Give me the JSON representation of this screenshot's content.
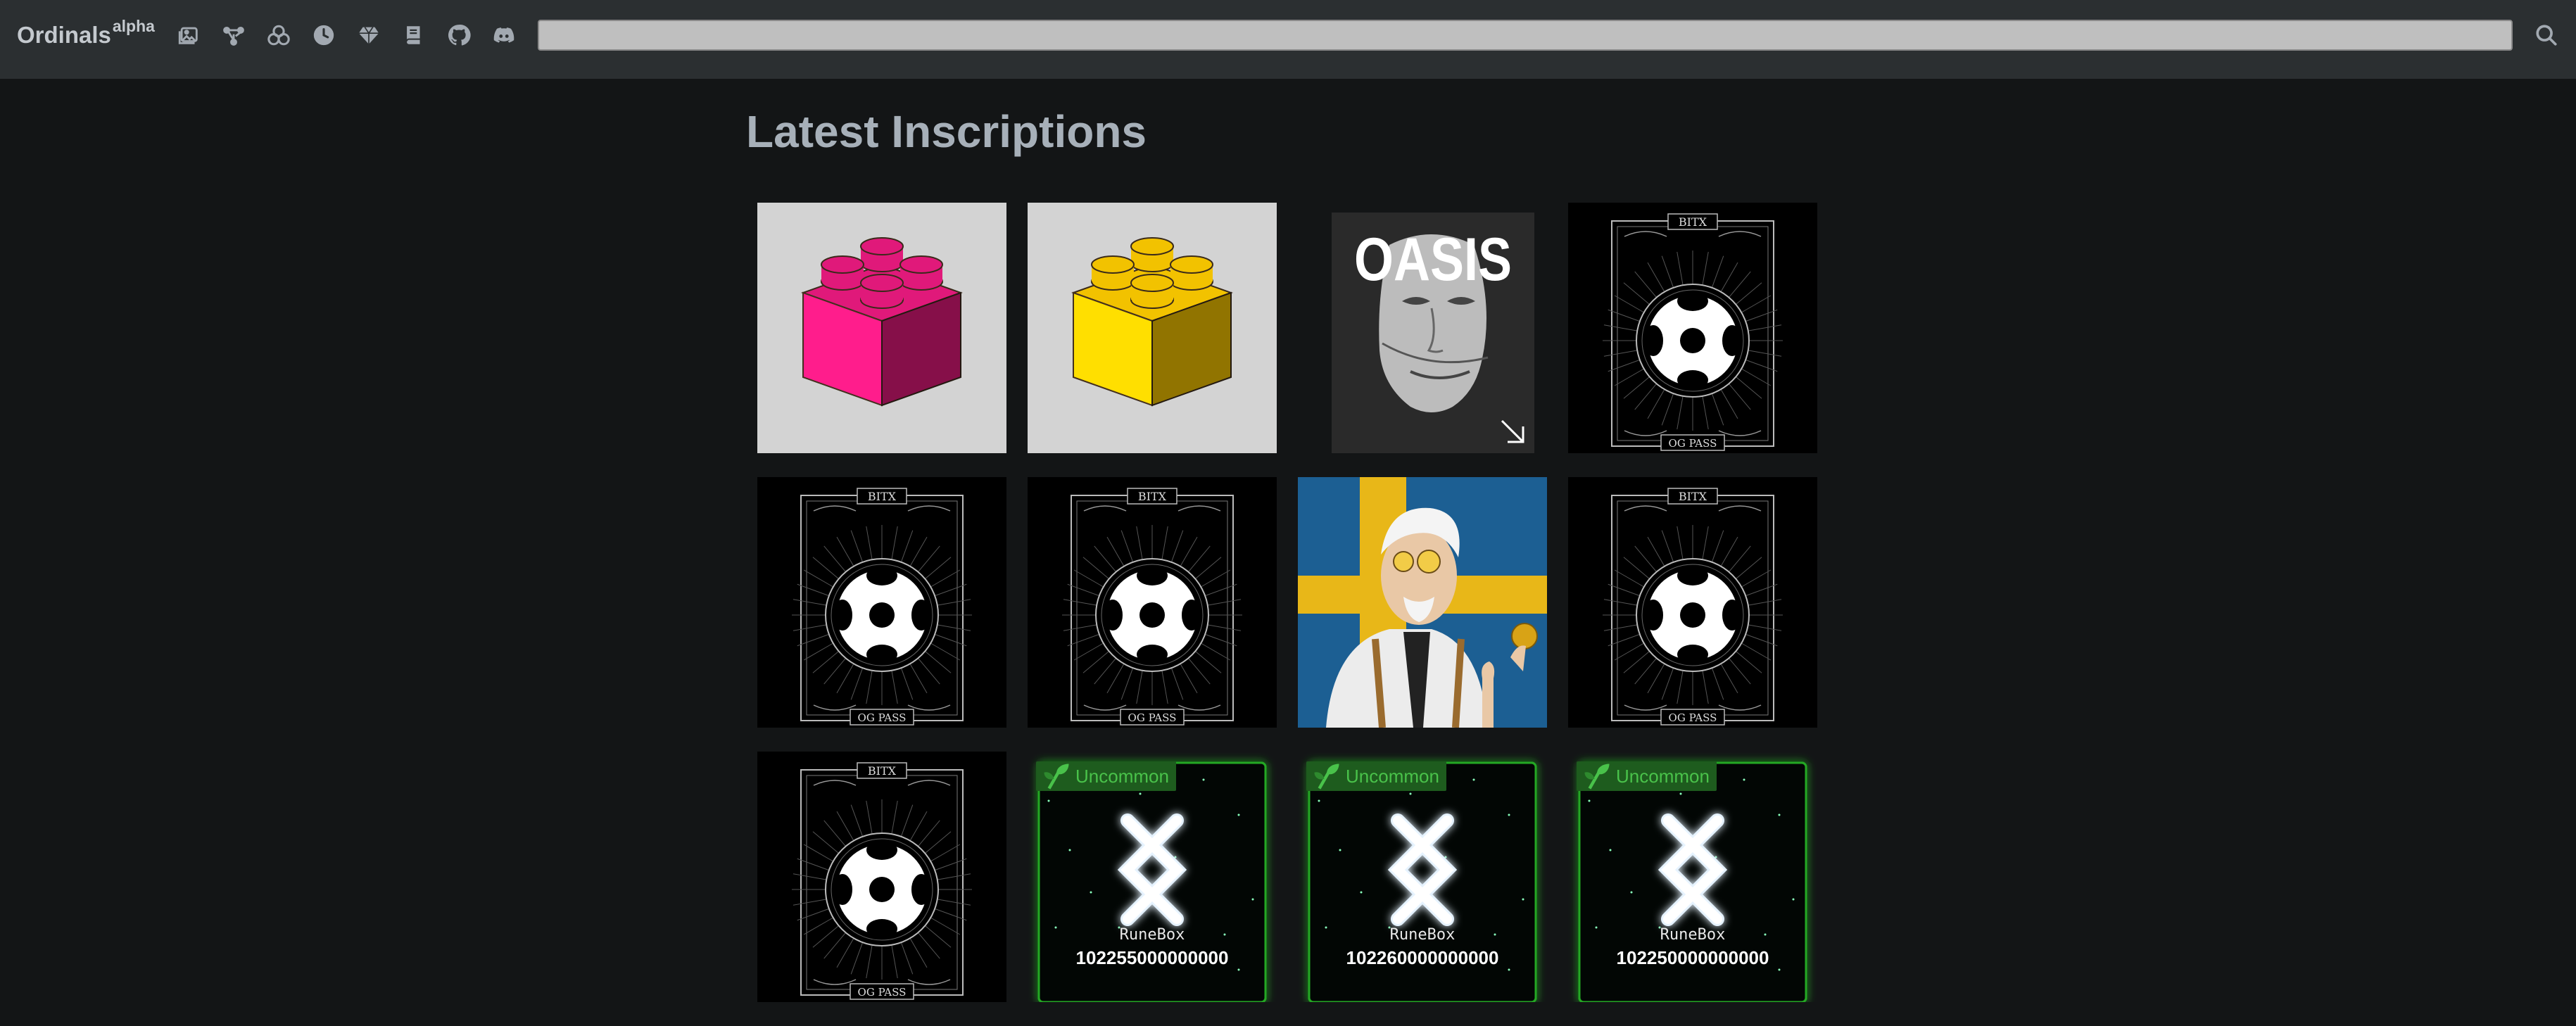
{
  "nav": {
    "brand": "Ordinals",
    "brand_sup": "alpha",
    "icons": [
      "gallery-icon",
      "network-icon",
      "blobs-icon",
      "clock-icon",
      "gem-icon",
      "book-icon",
      "github-icon",
      "discord-icon"
    ],
    "search_placeholder": "",
    "search_icon": "search-icon"
  },
  "page": {
    "title": "Latest Inscriptions"
  },
  "inscriptions": [
    {
      "kind": "brick",
      "color": "#e0197a"
    },
    {
      "kind": "brick",
      "color": "#f2c200"
    },
    {
      "kind": "oasis",
      "text": "OASIS"
    },
    {
      "kind": "ogpass",
      "top": "BITX",
      "bottom": "OG PASS"
    },
    {
      "kind": "ogpass",
      "top": "BITX",
      "bottom": "OG PASS"
    },
    {
      "kind": "ogpass",
      "top": "BITX",
      "bottom": "OG PASS"
    },
    {
      "kind": "portrait"
    },
    {
      "kind": "ogpass",
      "top": "BITX",
      "bottom": "OG PASS"
    },
    {
      "kind": "ogpass",
      "top": "BITX",
      "bottom": "OG PASS"
    },
    {
      "kind": "rune",
      "badge": "Uncommon",
      "name": "RuneBox",
      "amount": "102255000000000"
    },
    {
      "kind": "rune",
      "badge": "Uncommon",
      "name": "RuneBox",
      "amount": "102260000000000"
    },
    {
      "kind": "rune",
      "badge": "Uncommon",
      "name": "RuneBox",
      "amount": "102250000000000"
    }
  ]
}
